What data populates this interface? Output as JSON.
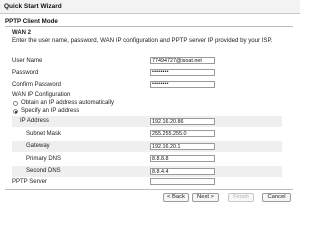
{
  "window": {
    "title": "Quick Start Wizard"
  },
  "section": {
    "title": "PPTP Client Mode"
  },
  "wan": {
    "label": "WAN 2",
    "description": "Enter the user name, password, WAN IP configuration and PPTP server IP provided by your ISP."
  },
  "fields": {
    "user_name": {
      "label": "User Name",
      "value": "77494727@isoat.net"
    },
    "password": {
      "label": "Password",
      "value": "••••••••"
    },
    "confirm_password": {
      "label": "Confirm Password",
      "value": "••••••••"
    }
  },
  "ip_config": {
    "label": "WAN IP Configuration",
    "option_auto": "Obtain an IP address automatically",
    "option_specify": "Specify an IP address",
    "selected": "specify",
    "ip_address": {
      "label": "IP Address",
      "value": "192.16.20.86"
    },
    "subnet_mask": {
      "label": "Subnet Mask",
      "value": "255.255.255.0"
    },
    "gateway": {
      "label": "Gateway",
      "value": "192.16.20.1"
    },
    "primary_dns": {
      "label": "Primary DNS",
      "value": "8.8.8.8"
    },
    "second_dns": {
      "label": "Second DNS",
      "value": "8.8.4.4"
    }
  },
  "pptp_server": {
    "label": "PPTP Server",
    "value": ""
  },
  "buttons": {
    "back": "< Back",
    "next": "Next >",
    "finish": "Finish",
    "cancel": "Cancel"
  }
}
